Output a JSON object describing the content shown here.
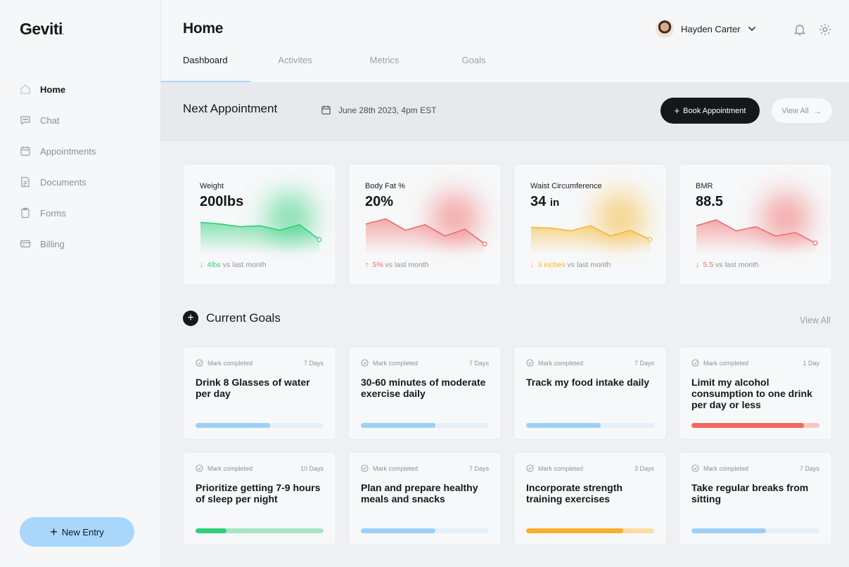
{
  "brand": {
    "name": "Geviti",
    "mark": "."
  },
  "sidebar": {
    "items": [
      {
        "label": "Home",
        "icon": "home-icon",
        "active": true
      },
      {
        "label": "Chat",
        "icon": "chat-icon"
      },
      {
        "label": "Appointments",
        "icon": "calendar-icon"
      },
      {
        "label": "Documents",
        "icon": "document-icon"
      },
      {
        "label": "Forms",
        "icon": "clipboard-icon"
      },
      {
        "label": "Billing",
        "icon": "credit-card-icon"
      }
    ],
    "new_entry_label": "New Entry"
  },
  "header": {
    "title": "Home",
    "user_name": "Hayden Carter",
    "tabs": [
      "Dashboard",
      "Activites",
      "Metrics",
      "Goals"
    ],
    "active_tab": "Dashboard"
  },
  "appointment": {
    "title": "Next Appointment",
    "date": "June 28th 2023, 4pm EST",
    "book_label": "Book Appointment",
    "view_all_label": "View All"
  },
  "metrics": [
    {
      "label": "Weight",
      "value": "200lbs",
      "unit": "",
      "change": "4lbs",
      "direction": "down",
      "suffix": "vs last month",
      "color": "#2fcf7a",
      "trend": [
        0.85,
        0.8,
        0.72,
        0.75,
        0.62,
        0.78,
        0.35
      ]
    },
    {
      "label": "Body Fat %",
      "value": "20%",
      "unit": "",
      "change": "5%",
      "direction": "up",
      "suffix": "vs last month",
      "color": "#f26b6b",
      "trend": [
        0.8,
        0.95,
        0.62,
        0.78,
        0.45,
        0.65,
        0.22
      ]
    },
    {
      "label": "Waist Circumference",
      "value": "34",
      "unit": "in",
      "change": "3 inches",
      "direction": "down",
      "suffix": "vs last month",
      "color": "#f6b733",
      "trend": [
        0.7,
        0.68,
        0.6,
        0.75,
        0.45,
        0.62,
        0.35
      ]
    },
    {
      "label": "BMR",
      "value": "88.5",
      "unit": "",
      "change": "5.5",
      "direction": "down",
      "suffix": "vs last month",
      "color": "#f26b6b",
      "trend": [
        0.75,
        0.92,
        0.6,
        0.72,
        0.45,
        0.55,
        0.25
      ]
    }
  ],
  "goals": {
    "title": "Current Goals",
    "view_all_label": "View All",
    "mark_label": "Mark completed",
    "items": [
      {
        "title": "Drink 8 Glasses of water per day",
        "days": "7 Days",
        "progress": 0.58,
        "color": "#9ed0f7",
        "track": "#e4f1fb"
      },
      {
        "title": "30-60 minutes of moderate exercise daily",
        "days": "7 Days",
        "progress": 0.58,
        "color": "#9ed0f7",
        "track": "#e4f1fb"
      },
      {
        "title": "Track my food intake daily",
        "days": "7 Days",
        "progress": 0.58,
        "color": "#9ed0f7",
        "track": "#e4f1fb"
      },
      {
        "title": "Limit my alcohol consumption to one drink per day or less",
        "days": "1 Day",
        "progress": 0.88,
        "color": "#ee6b62",
        "track": "#f9c6c2"
      },
      {
        "title": "Prioritize getting 7-9 hours of sleep per night",
        "days": "10 Days",
        "progress": 0.24,
        "color": "#2fcf7a",
        "track": "#a8e5c4"
      },
      {
        "title": "Plan and prepare healthy meals and snacks",
        "days": "7 Days",
        "progress": 0.58,
        "color": "#9ed0f7",
        "track": "#e4f1fb"
      },
      {
        "title": "Incorporate strength training exercises",
        "days": "3 Days",
        "progress": 0.76,
        "color": "#f6b02d",
        "track": "#fbdca6"
      },
      {
        "title": "Take regular breaks from sitting",
        "days": "7 Days",
        "progress": 0.58,
        "color": "#9ed0f7",
        "track": "#e4f1fb"
      }
    ]
  }
}
